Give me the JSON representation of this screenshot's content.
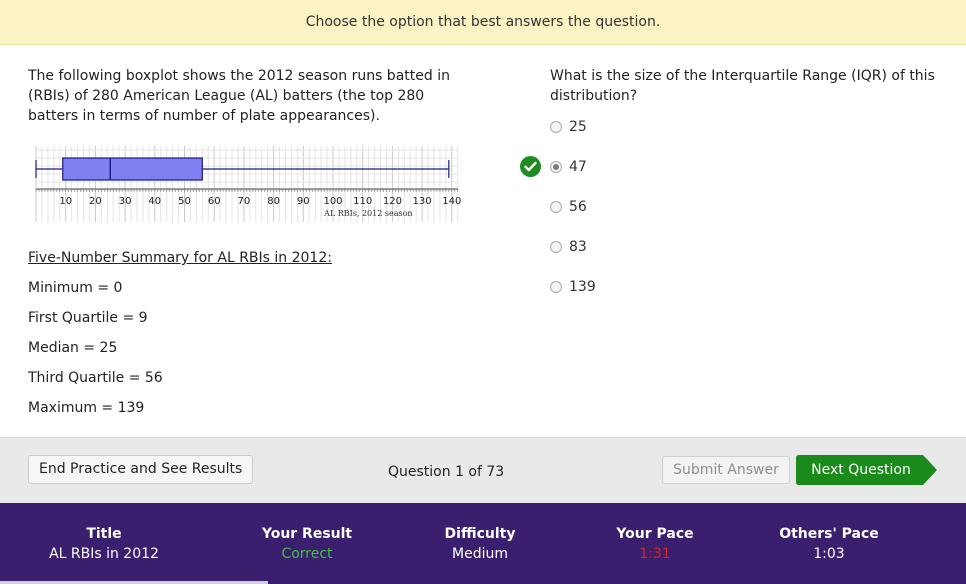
{
  "instruction": "Choose the option that best answers the question.",
  "prompt": "The following boxplot shows the 2012 season runs batted in (RBIs) of 280 American League (AL) batters (the top 280 batters in terms of number of plate appearances).",
  "chart_data": {
    "type": "boxplot",
    "xlabel": "AL RBIs, 2012 season",
    "ticks": [
      10,
      20,
      30,
      40,
      50,
      60,
      70,
      80,
      90,
      100,
      110,
      120,
      130,
      140
    ],
    "xlim": [
      0,
      142
    ],
    "min": 0,
    "q1": 9,
    "median": 25,
    "q3": 56,
    "max": 139,
    "box_color": "#8080f0"
  },
  "summary": {
    "title": "Five-Number Summary for AL RBIs in 2012:",
    "items": [
      "Minimum = 0",
      "First Quartile = 9",
      "Median = 25",
      "Third Quartile = 56",
      "Maximum = 139"
    ]
  },
  "question": "What is the size of the Interquartile Range (IQR) of this distribution?",
  "options": [
    {
      "label": "25",
      "selected": false
    },
    {
      "label": "47",
      "selected": true,
      "correct": true
    },
    {
      "label": "56",
      "selected": false
    },
    {
      "label": "83",
      "selected": false
    },
    {
      "label": "139",
      "selected": false
    }
  ],
  "actions": {
    "end_label": "End Practice and See Results",
    "progress": "Question 1 of 73",
    "submit_label": "Submit Answer",
    "next_label": "Next Question"
  },
  "stats": {
    "title_label": "Title",
    "title_value": "AL RBIs in 2012",
    "result_label": "Your Result",
    "result_value": "Correct",
    "difficulty_label": "Difficulty",
    "difficulty_value": "Medium",
    "pace_label": "Your Pace",
    "pace_value": "1:31",
    "others_label": "Others' Pace",
    "others_value": "1:03"
  },
  "colors": {
    "banner": "#fbf3c4",
    "correct_green": "#1f8a1f",
    "result_green": "#3cc43c",
    "pace_red": "#e02020",
    "stats_purple": "#3a1f6e",
    "next_green": "#1a8a1a"
  },
  "icons": {
    "correct": "check-circle-icon",
    "next": "arrow-right-icon"
  }
}
